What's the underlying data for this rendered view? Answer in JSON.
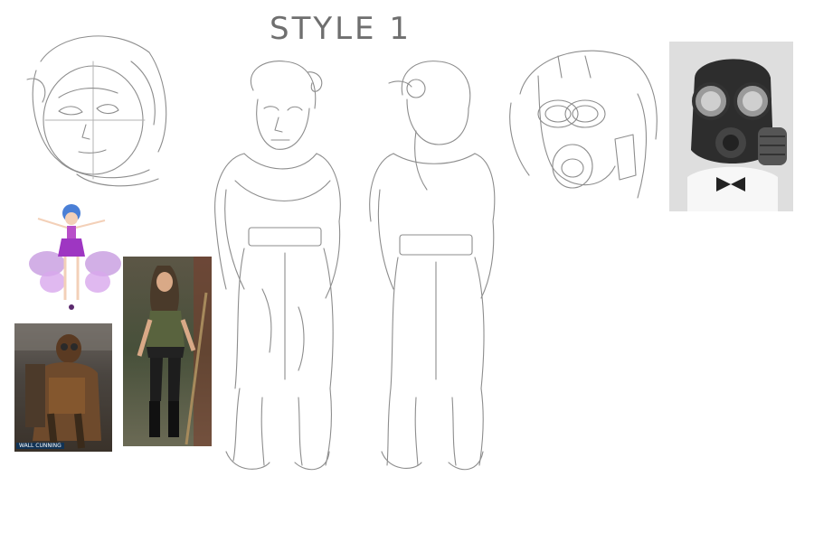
{
  "sheet": {
    "title": "STYLE 1",
    "background": "#ffffff",
    "ink_color": "#8d8d8d"
  },
  "references": {
    "wasteland_caption": "WALL CUNNING"
  }
}
